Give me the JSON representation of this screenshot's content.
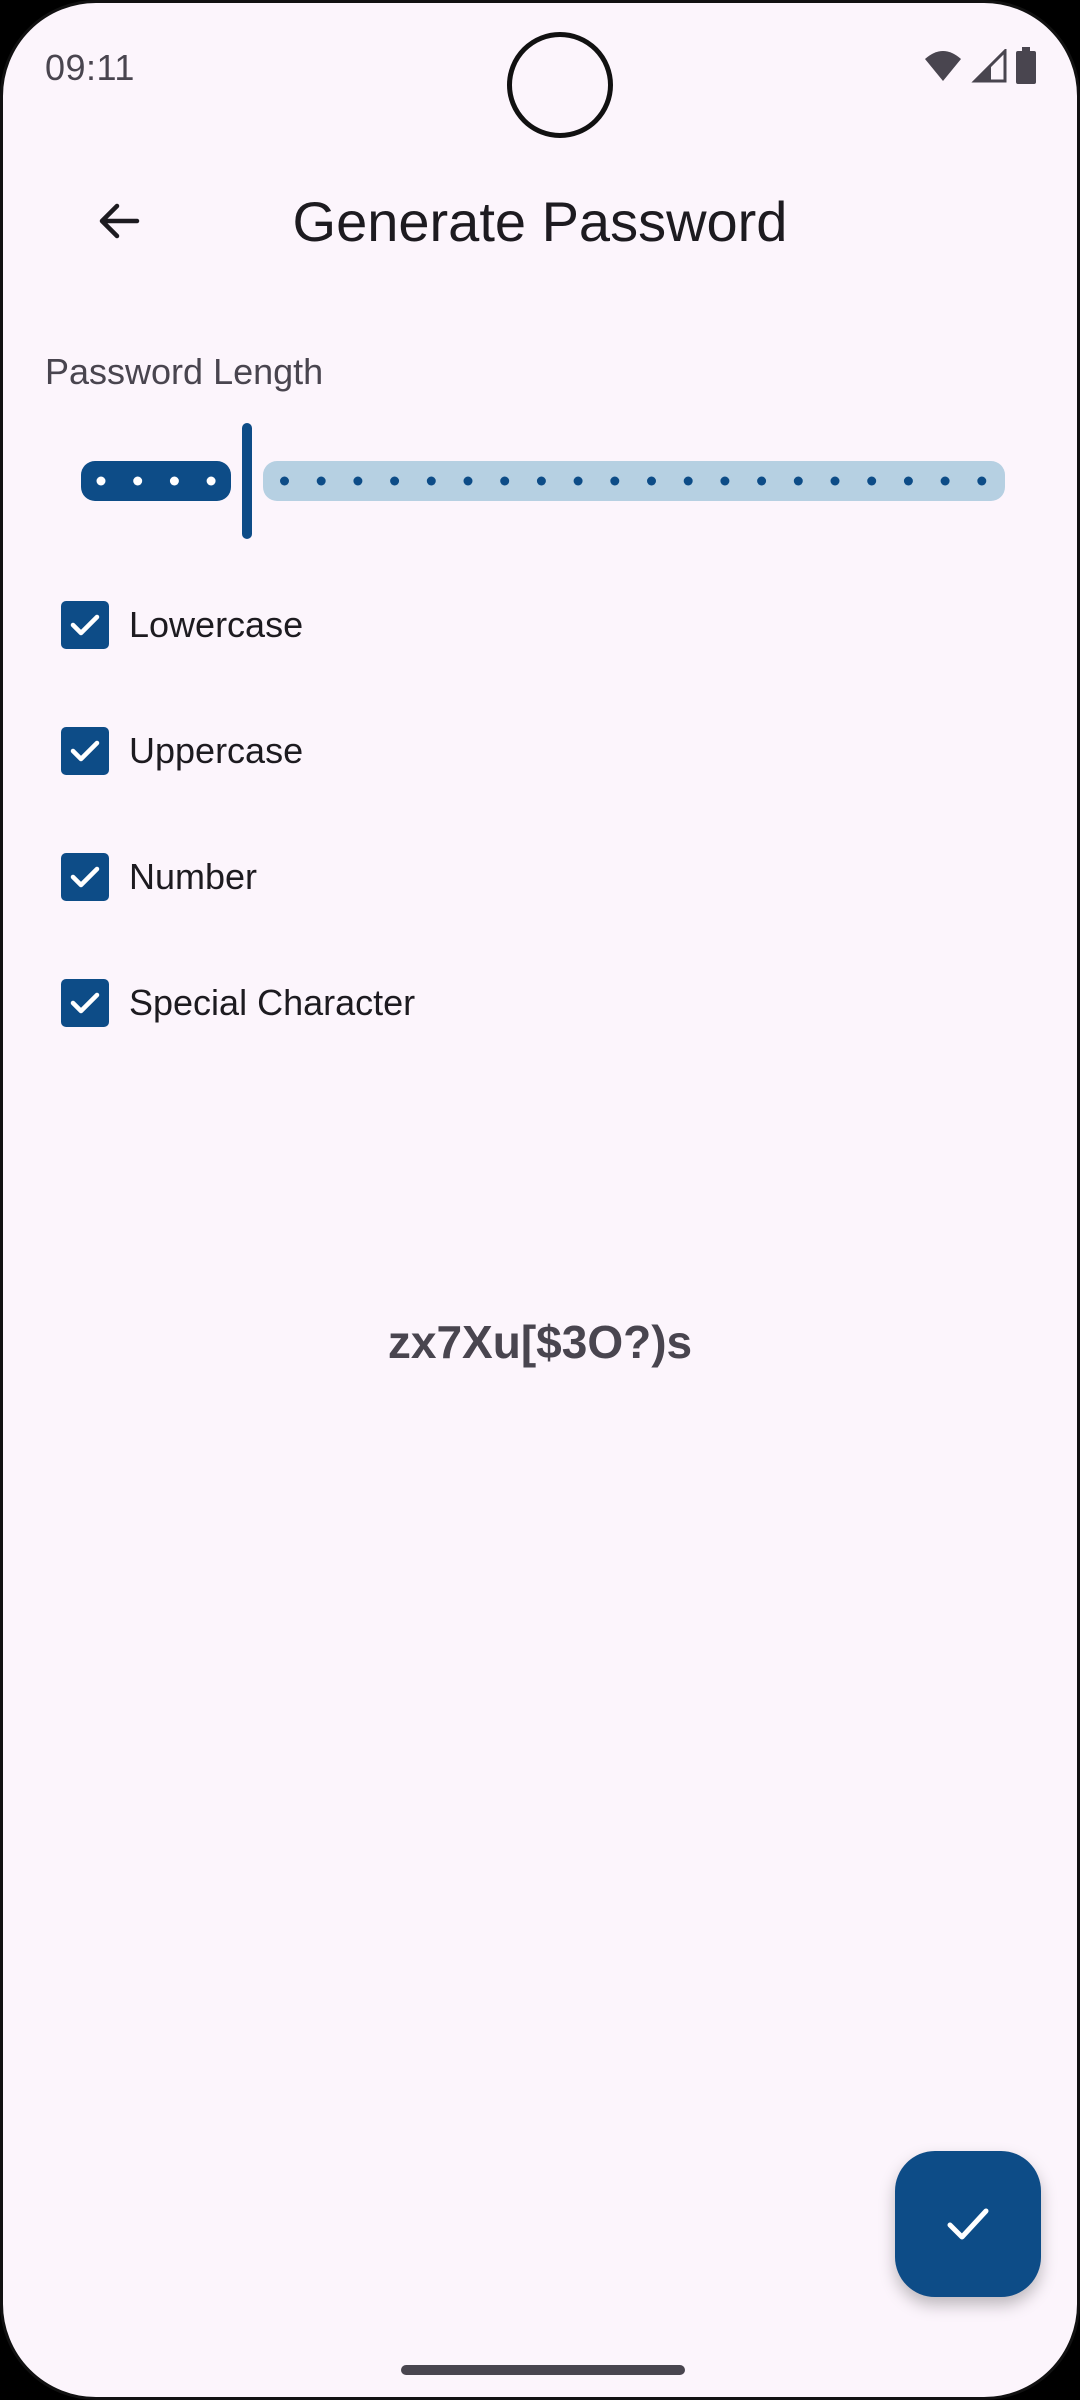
{
  "status_bar": {
    "time": "09:11",
    "icons": [
      "wifi-icon",
      "cell-signal-icon",
      "battery-icon"
    ]
  },
  "app_bar": {
    "title": "Generate Password",
    "back_icon": "arrow-back-icon"
  },
  "password_length": {
    "label": "Password Length",
    "value_fraction": 0.18,
    "active_color": "#0D4C87",
    "inactive_color": "#B6D0E2"
  },
  "options": [
    {
      "label": "Lowercase",
      "checked": true
    },
    {
      "label": "Uppercase",
      "checked": true
    },
    {
      "label": "Number",
      "checked": true
    },
    {
      "label": "Special Character",
      "checked": true
    }
  ],
  "generated_password": "zx7Xu[$3O?)s",
  "fab": {
    "icon": "check-icon"
  },
  "colors": {
    "background": "#FCF5FC",
    "primary": "#0D4C87",
    "on_surface": "#1D1B20",
    "on_surface_variant": "#49454F"
  }
}
